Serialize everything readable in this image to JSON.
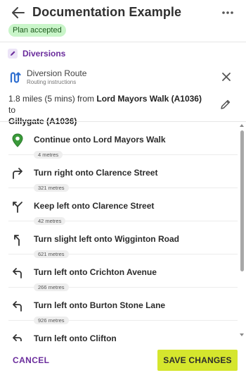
{
  "header": {
    "title": "Documentation Example",
    "badge": "Plan accepted",
    "back_icon": "arrow-left-icon",
    "more_icon": "more-horizontal-icon"
  },
  "section": {
    "label": "Diversions",
    "icon": "pencil-icon"
  },
  "route": {
    "title": "Diversion Route",
    "subtitle": "Routing instructions",
    "icon": "route-icon",
    "close_icon": "close-icon",
    "summary_prefix": "1.8 miles (5 mins) from ",
    "from": "Lord Mayors Walk (A1036)",
    "summary_mid": " to",
    "to": "Gillygate (A1036)",
    "edit_icon": "pencil-icon"
  },
  "steps": [
    {
      "text": "Continue onto Lord Mayors Walk",
      "distance": "4 metres",
      "icon": "map-pin-icon"
    },
    {
      "text": "Turn right onto Clarence Street",
      "distance": "321 metres",
      "icon": "turn-right-icon"
    },
    {
      "text": "Keep left onto Clarence Street",
      "distance": "42 metres",
      "icon": "keep-left-icon"
    },
    {
      "text": "Turn slight left onto Wigginton Road",
      "distance": "621 metres",
      "icon": "slight-left-icon"
    },
    {
      "text": "Turn left onto Crichton Avenue",
      "distance": "266 metres",
      "icon": "turn-left-icon"
    },
    {
      "text": "Turn left onto Burton Stone Lane",
      "distance": "926 metres",
      "icon": "turn-left-icon"
    },
    {
      "text": "Turn left onto Clifton",
      "distance": "",
      "icon": "turn-left-icon"
    }
  ],
  "footer": {
    "cancel_label": "CANCEL",
    "save_label": "SAVE CHANGES"
  },
  "colors": {
    "accent": "#6a2c9c",
    "badge_bg": "#c9f5c9",
    "save_bg": "#d5e62d",
    "pin_green": "#3a9a3a",
    "route_blue": "#2f6fd0"
  }
}
